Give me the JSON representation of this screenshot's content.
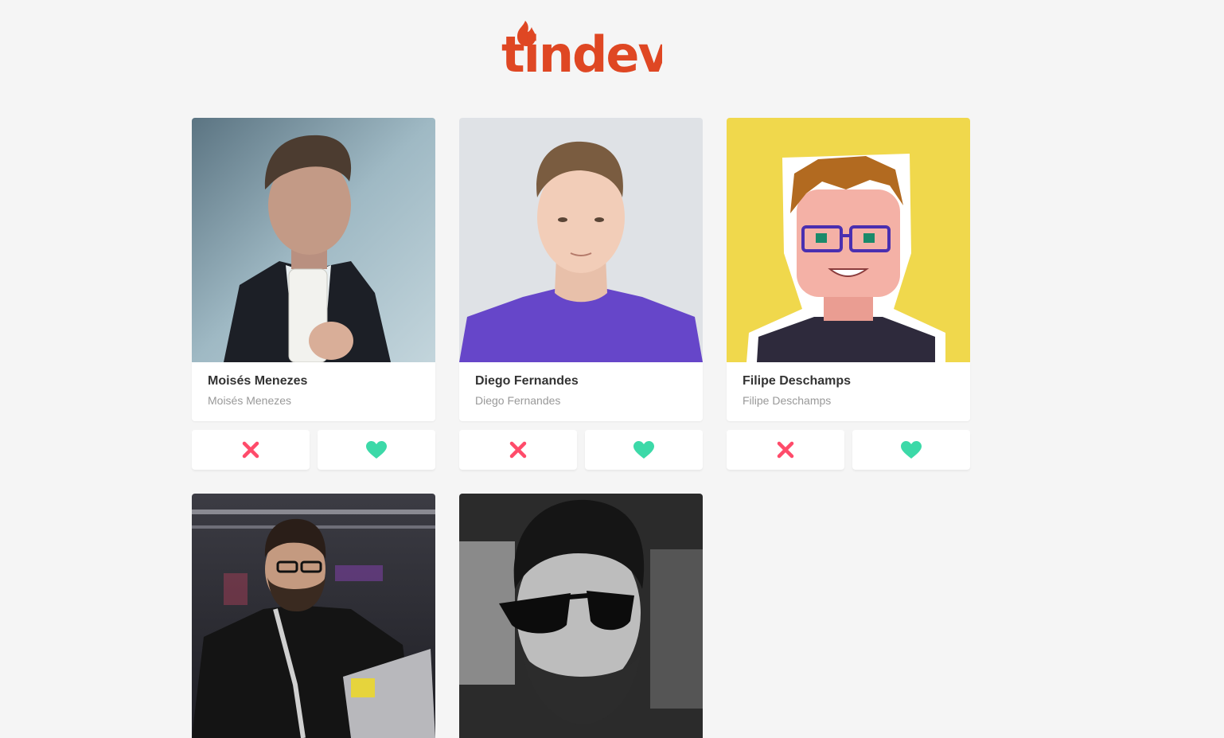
{
  "app": {
    "logo_text": "tindev",
    "logo_color": "#df4723"
  },
  "colors": {
    "dislike": "#ff4b6a",
    "like": "#3cd9a8",
    "background": "#f5f5f5"
  },
  "icons": {
    "dislike": "close-icon",
    "like": "heart-icon"
  },
  "users": [
    {
      "name": "Moisés Menezes",
      "bio": "Moisés Menezes"
    },
    {
      "name": "Diego Fernandes",
      "bio": "Diego Fernandes"
    },
    {
      "name": "Filipe Deschamps",
      "bio": "Filipe Deschamps"
    },
    {
      "name": "",
      "bio": ""
    },
    {
      "name": "",
      "bio": ""
    }
  ]
}
